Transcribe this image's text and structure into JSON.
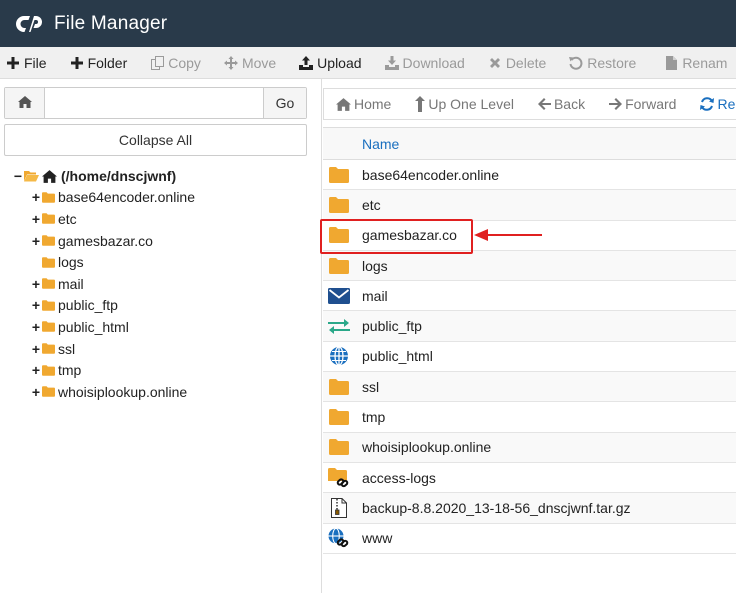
{
  "header": {
    "title": "File Manager",
    "logo": "cpanel-logo"
  },
  "toolbar": {
    "items": [
      {
        "label": "File",
        "icon": "plus-icon",
        "enabled": true
      },
      {
        "label": "Folder",
        "icon": "plus-icon",
        "enabled": true
      },
      {
        "label": "Copy",
        "icon": "copy-icon",
        "enabled": false
      },
      {
        "label": "Move",
        "icon": "move-icon",
        "enabled": false
      },
      {
        "label": "Upload",
        "icon": "upload-icon",
        "enabled": true
      },
      {
        "label": "Download",
        "icon": "download-icon",
        "enabled": false
      },
      {
        "label": "Delete",
        "icon": "delete-icon",
        "enabled": false
      },
      {
        "label": "Restore",
        "icon": "restore-icon",
        "enabled": false
      },
      {
        "label": "Renam",
        "icon": "file-icon",
        "enabled": false
      }
    ]
  },
  "pathbar": {
    "value": "",
    "go_label": "Go"
  },
  "left": {
    "collapse_label": "Collapse All"
  },
  "tree": {
    "root": {
      "label": "(/home/dnscjwnf)",
      "toggle": "−"
    },
    "children": [
      {
        "label": "base64encoder.online",
        "toggle": "+"
      },
      {
        "label": "etc",
        "toggle": "+"
      },
      {
        "label": "gamesbazar.co",
        "toggle": "+"
      },
      {
        "label": "logs",
        "toggle": ""
      },
      {
        "label": "mail",
        "toggle": "+"
      },
      {
        "label": "public_ftp",
        "toggle": "+"
      },
      {
        "label": "public_html",
        "toggle": "+"
      },
      {
        "label": "ssl",
        "toggle": "+"
      },
      {
        "label": "tmp",
        "toggle": "+"
      },
      {
        "label": "whoisiplookup.online",
        "toggle": "+"
      }
    ]
  },
  "nav": {
    "home": "Home",
    "up": "Up One Level",
    "back": "Back",
    "forward": "Forward",
    "reload": "Re"
  },
  "table": {
    "column_name": "Name",
    "rows": [
      {
        "name": "base64encoder.online",
        "icon": "folder-icon"
      },
      {
        "name": "etc",
        "icon": "folder-icon"
      },
      {
        "name": "gamesbazar.co",
        "icon": "folder-icon"
      },
      {
        "name": "logs",
        "icon": "folder-icon"
      },
      {
        "name": "mail",
        "icon": "mail-icon"
      },
      {
        "name": "public_ftp",
        "icon": "transfer-icon"
      },
      {
        "name": "public_html",
        "icon": "globe-icon"
      },
      {
        "name": "ssl",
        "icon": "folder-icon"
      },
      {
        "name": "tmp",
        "icon": "folder-icon"
      },
      {
        "name": "whoisiplookup.online",
        "icon": "folder-icon"
      },
      {
        "name": "access-logs",
        "icon": "folder-link-icon"
      },
      {
        "name": "backup-8.8.2020_13-18-56_dnscjwnf.tar.gz",
        "icon": "archive-icon"
      },
      {
        "name": "www",
        "icon": "globe-link-icon"
      }
    ]
  },
  "colors": {
    "header_bg": "#293a4a",
    "folder": "#f0a830",
    "accent": "#1a6fbf",
    "highlight": "#e02020"
  }
}
